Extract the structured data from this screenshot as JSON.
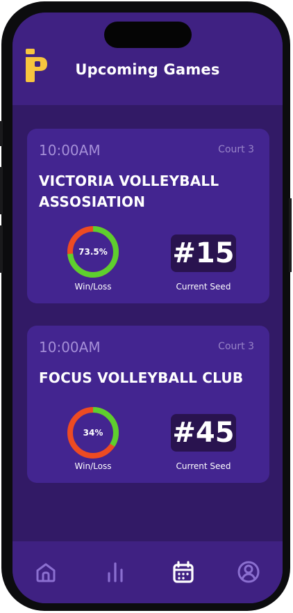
{
  "header": {
    "title": "Upcoming Games"
  },
  "games": [
    {
      "time": "10:00AM",
      "court": "Court 3",
      "team_line1": "VICTORIA VOLLEYBALL",
      "team_line2": "ASSOSIATION",
      "win_pct": 73.5,
      "win_label": "73.5%",
      "win_caption": "Win/Loss",
      "seed": "#15",
      "seed_caption": "Current Seed"
    },
    {
      "time": "10:00AM",
      "court": "Court 3",
      "team_line1": "FOCUS VOLLEYBALL CLUB",
      "team_line2": "",
      "win_pct": 34,
      "win_label": "34%",
      "win_caption": "Win/Loss",
      "seed": "#45",
      "seed_caption": "Current Seed"
    }
  ],
  "nav": {
    "items": [
      {
        "icon": "home-icon",
        "active": false
      },
      {
        "icon": "stats-icon",
        "active": false
      },
      {
        "icon": "calendar-icon",
        "active": true
      },
      {
        "icon": "profile-icon",
        "active": false
      }
    ]
  },
  "colors": {
    "background": "#321a66",
    "header": "#3f2182",
    "card": "#432590",
    "seed_box": "#29134f",
    "win": "#5ecf2e",
    "loss": "#ee4b22",
    "logo": "#f7c53f",
    "nav_active": "#ffffff",
    "nav_inactive": "#8b6fd0"
  }
}
